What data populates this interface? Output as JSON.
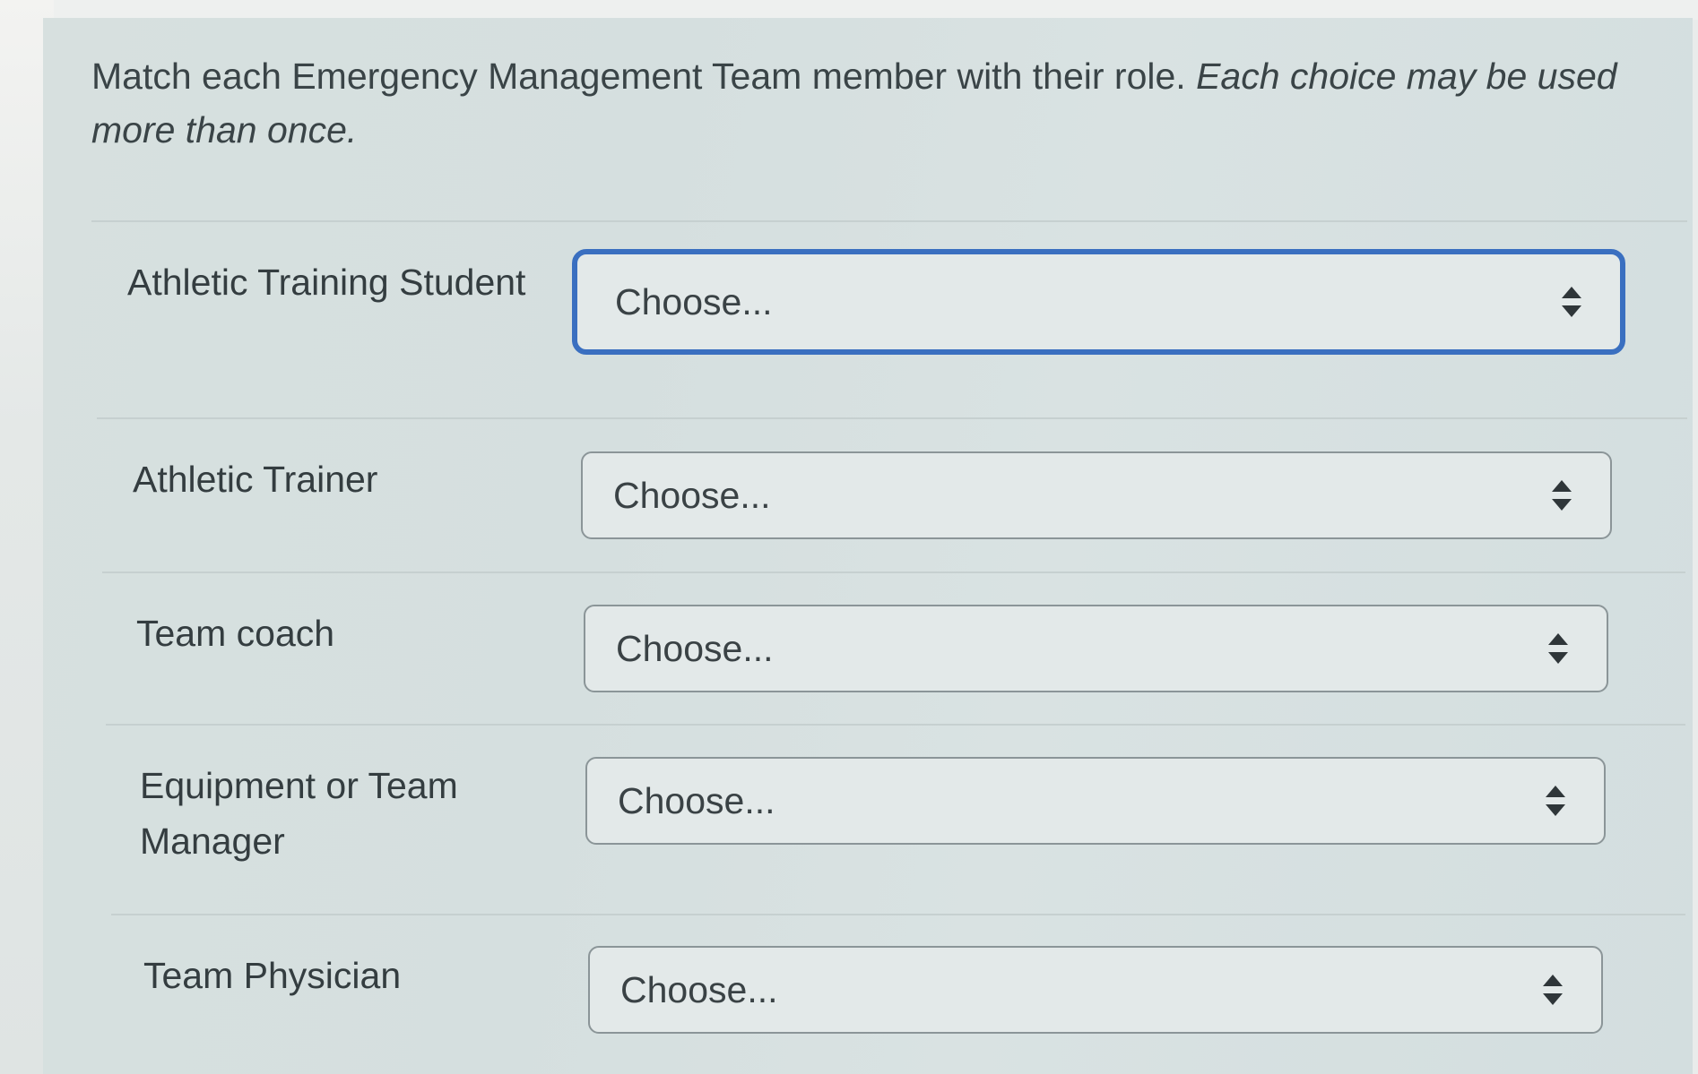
{
  "prompt": {
    "text": "Match each Emergency Management Team member with their role. ",
    "italic": "Each choice may be used more than once."
  },
  "rows": [
    {
      "label": "Athletic Training Student",
      "select": {
        "value": "Choose...",
        "focused": true
      }
    },
    {
      "label": "Athletic Trainer",
      "select": {
        "value": "Choose...",
        "focused": false
      }
    },
    {
      "label": "Team coach",
      "select": {
        "value": "Choose...",
        "focused": false
      }
    },
    {
      "label": "Equipment or Team Manager",
      "select": {
        "value": "Choose...",
        "focused": false
      }
    },
    {
      "label": "Team Physician",
      "select": {
        "value": "Choose...",
        "focused": false
      }
    }
  ],
  "icons": {
    "select_arrow": "up-down-chevron-icon"
  },
  "colors": {
    "focus_border": "#3a6fc0",
    "panel_bg": "#d7e0df"
  }
}
